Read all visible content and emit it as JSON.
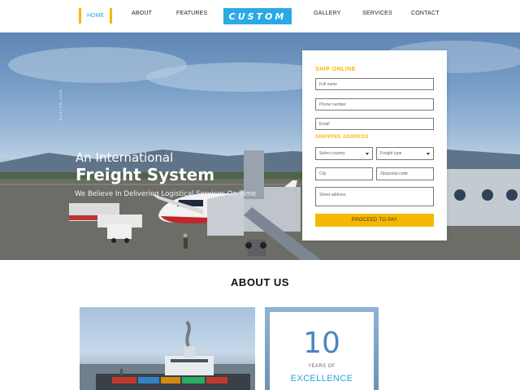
{
  "nav": {
    "items": [
      "HOME",
      "ABOUT",
      "FEATURES",
      "GALLERY",
      "SERVICES",
      "CONTACT"
    ],
    "active": "HOME",
    "logo": "CUSTOM",
    "accent": "#f5b800",
    "brand": "#2aa9e6"
  },
  "hero": {
    "vertical_tag": "CUSTOM.COM",
    "subtitle": "An International",
    "title": "Freight System",
    "tagline": "We Believe In Delivering Logistical Services On Time"
  },
  "form": {
    "heading": "SHIP ONLINE",
    "name_placeholder": "Full name",
    "phone_placeholder": "Phone number",
    "email_placeholder": "Email",
    "shipping_heading": "SHIPPING ADDRESS",
    "country_select": "Select country",
    "freight_select": "Freight type",
    "city_placeholder": "City",
    "zip_placeholder": "Zip/postal code",
    "street_placeholder": "Street address",
    "button_label": "PROCEED TO PAY"
  },
  "about": {
    "title": "ABOUT US",
    "stat_number": "10",
    "stat_unit": "YEARS OF",
    "stat_label": "EXCELLENCE"
  }
}
